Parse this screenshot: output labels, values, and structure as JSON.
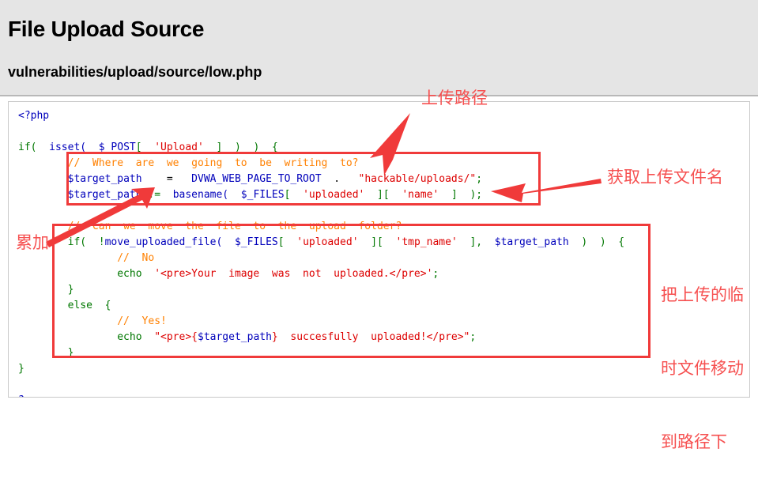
{
  "header": {
    "title": "File Upload Source",
    "file_path": "vulnerabilities/upload/source/low.php"
  },
  "code": {
    "language": "php",
    "lines": [
      "<?php",
      "",
      "if( isset( $_POST[ 'Upload' ] ) ) {",
      "    // Where are we going to be writing to?",
      "    $target_path  =  DVWA_WEB_PAGE_TO_ROOT . \"hackable/uploads/\";",
      "    $target_path .= basename( $_FILES[ 'uploaded' ][ 'name' ] );",
      "",
      "    // Can we move the file to the upload folder?",
      "    if( !move_uploaded_file( $_FILES[ 'uploaded' ][ 'tmp_name' ], $target_path ) ) {",
      "        // No",
      "        echo '<pre>Your image was not uploaded.</pre>';",
      "    }",
      "    else {",
      "        // Yes!",
      "        echo \"<pre>{$target_path} succesfully uploaded!</pre>\";",
      "    }",
      "}",
      "",
      "?>"
    ]
  },
  "annotations": {
    "color": "#f65050",
    "box_color": "#f03a3a",
    "upload_path_label": "上传路径",
    "get_filename_label": "获取上传文件名",
    "append_label": "累加",
    "move_tmp_label_line1": "把上传的临",
    "move_tmp_label_line2": "时文件移动",
    "move_tmp_label_line3": "到路径下"
  },
  "colors": {
    "header_background": "#e5e5e5",
    "code_background": "#ffffff",
    "code_border": "#c9c9c9",
    "php_keyword": "#007700",
    "php_variable": "#0000BB",
    "php_string": "#DD0000",
    "php_comment": "#FF8000",
    "php_default": "#000000"
  }
}
